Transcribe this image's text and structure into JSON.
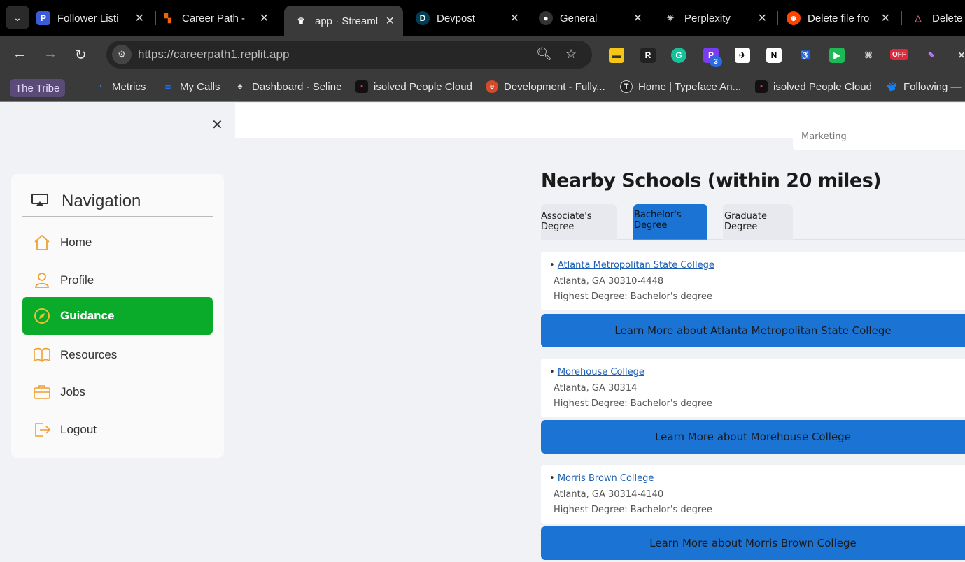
{
  "browser": {
    "tabs": [
      {
        "title": "Follower Listi",
        "icon": "p-app-icon",
        "color": "#3b5bdb"
      },
      {
        "title": "Career Path -",
        "icon": "replit-icon",
        "color": "#f26207"
      },
      {
        "title": "app · Streamli",
        "icon": "streamlit-crown-icon",
        "color": "#ffffff"
      },
      {
        "title": "Devpost",
        "icon": "devpost-icon",
        "color": "#003e54"
      },
      {
        "title": "General",
        "icon": "github-icon",
        "color": "#333333"
      },
      {
        "title": "Perplexity",
        "icon": "perplexity-icon",
        "color": "#222222"
      },
      {
        "title": "Delete file fro",
        "icon": "reddit-icon",
        "color": "#ff4500"
      },
      {
        "title": "Delete",
        "icon": "delta-icon",
        "color": "#b03060"
      }
    ],
    "url": "https://careerpath1.replit.app",
    "extension_badge": "3",
    "extension_off": "OFF",
    "bookmarks": [
      {
        "label": "The Tribe"
      },
      {
        "label": "Metrics",
        "icon": "metrics-icon",
        "color": "#2a7de1"
      },
      {
        "label": "My Calls",
        "icon": "calls-icon",
        "color": "#1e6fff"
      },
      {
        "label": "Dashboard - Seline",
        "icon": "seline-icon",
        "color": "#555555"
      },
      {
        "label": "isolved People Cloud",
        "icon": "isolved-icon",
        "color": "#111111"
      },
      {
        "label": "Development - Fully...",
        "icon": "edge-icon",
        "color": "#d44a2a"
      },
      {
        "label": "Home | Typeface An...",
        "icon": "typeface-icon",
        "color": "#333333"
      },
      {
        "label": "isolved People Cloud",
        "icon": "isolved-icon",
        "color": "#111111"
      },
      {
        "label": "Following —",
        "icon": "bluesky-icon",
        "color": "#1185fe"
      }
    ]
  },
  "sidebar": {
    "title": "Navigation",
    "items": [
      {
        "label": "Home",
        "icon": "home-icon"
      },
      {
        "label": "Profile",
        "icon": "person-icon"
      },
      {
        "label": "Guidance",
        "icon": "compass-icon",
        "active": true
      },
      {
        "label": "Resources",
        "icon": "book-icon"
      },
      {
        "label": "Jobs",
        "icon": "briefcase-icon"
      },
      {
        "label": "Logout",
        "icon": "logout-icon"
      }
    ]
  },
  "main": {
    "prev_card_text": "Marketing",
    "section_title": "Nearby Schools (within 20 miles)",
    "tabs": [
      {
        "label": "Associate's Degree"
      },
      {
        "label": "Bachelor's Degree",
        "selected": true
      },
      {
        "label": "Graduate Degree"
      }
    ],
    "schools": [
      {
        "name": "Atlanta Metropolitan State College",
        "address": "Atlanta, GA 30310-4448",
        "degree": "Highest Degree: Bachelor's degree",
        "button": "Learn More about Atlanta Metropolitan State College"
      },
      {
        "name": "Morehouse College",
        "address": "Atlanta, GA 30314",
        "degree": "Highest Degree: Bachelor's degree",
        "button": "Learn More about Morehouse College"
      },
      {
        "name": "Morris Brown College",
        "address": "Atlanta, GA 30314-4140",
        "degree": "Highest Degree: Bachelor's degree",
        "button": "Learn More about Morris Brown College"
      }
    ]
  },
  "colors": {
    "accent_active": "#0aaa2a",
    "button_blue": "#1b74d4",
    "icon_orange": "#f0a030",
    "tab_underline": "#ff4b4b"
  }
}
